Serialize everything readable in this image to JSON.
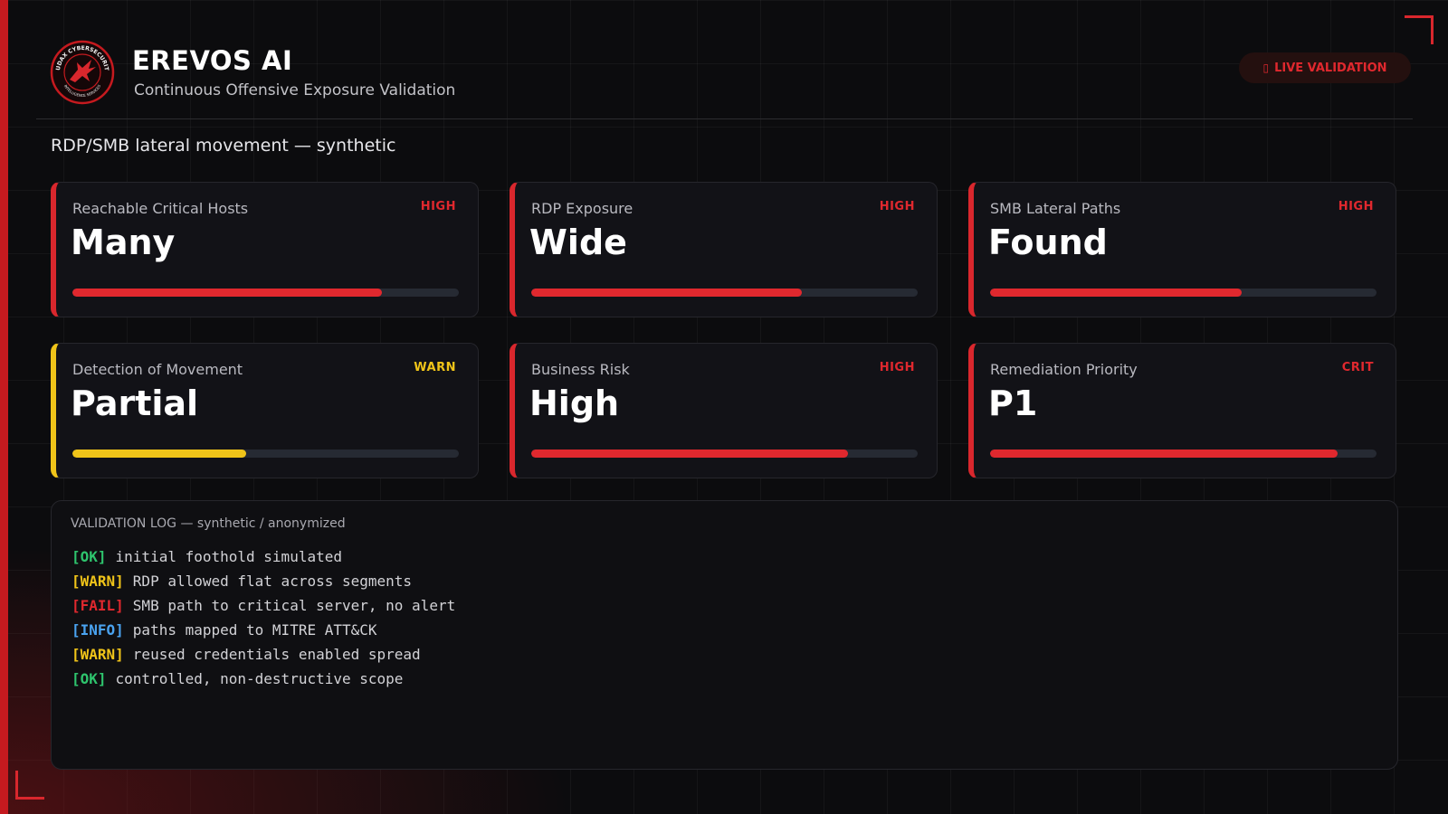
{
  "brand": {
    "title": "EREVOS AI",
    "subtitle": "Continuous Offensive Exposure Validation",
    "logo_ring_text_top": "AUDAX CYBERSECURITY",
    "logo_ring_text_bottom": "INTELLIGENCE SERVICES"
  },
  "status_badge": {
    "icon": "live-indicator-icon",
    "label": "LIVE VALIDATION"
  },
  "scenario_title": "RDP/SMB lateral movement — synthetic",
  "colors": {
    "accent": "#d9272d",
    "warn": "#f0c419",
    "ok": "#2ec46d",
    "info": "#4aa3f0"
  },
  "cards": [
    {
      "label": "Reachable Critical Hosts",
      "badge": "HIGH",
      "value": "Many",
      "level": 0.8
    },
    {
      "label": "RDP Exposure",
      "badge": "HIGH",
      "value": "Wide",
      "level": 0.7
    },
    {
      "label": "SMB Lateral Paths",
      "badge": "HIGH",
      "value": "Found",
      "level": 0.65
    },
    {
      "label": "Detection of Movement",
      "badge": "WARN",
      "value": "Partial",
      "level": 0.45
    },
    {
      "label": "Business Risk",
      "badge": "HIGH",
      "value": "High",
      "level": 0.82
    },
    {
      "label": "Remediation Priority",
      "badge": "CRIT",
      "value": "P1",
      "level": 0.9
    }
  ],
  "log": {
    "title": "VALIDATION LOG — synthetic / anonymized",
    "lines": [
      {
        "tag": "[OK]",
        "text": "initial foothold simulated"
      },
      {
        "tag": "[WARN]",
        "text": "RDP allowed flat across segments"
      },
      {
        "tag": "[FAIL]",
        "text": "SMB path to critical server, no alert"
      },
      {
        "tag": "[INFO]",
        "text": "paths mapped to MITRE ATT&CK"
      },
      {
        "tag": "[WARN]",
        "text": "reused credentials enabled spread"
      },
      {
        "tag": "[OK]",
        "text": "controlled, non-destructive scope"
      }
    ]
  }
}
